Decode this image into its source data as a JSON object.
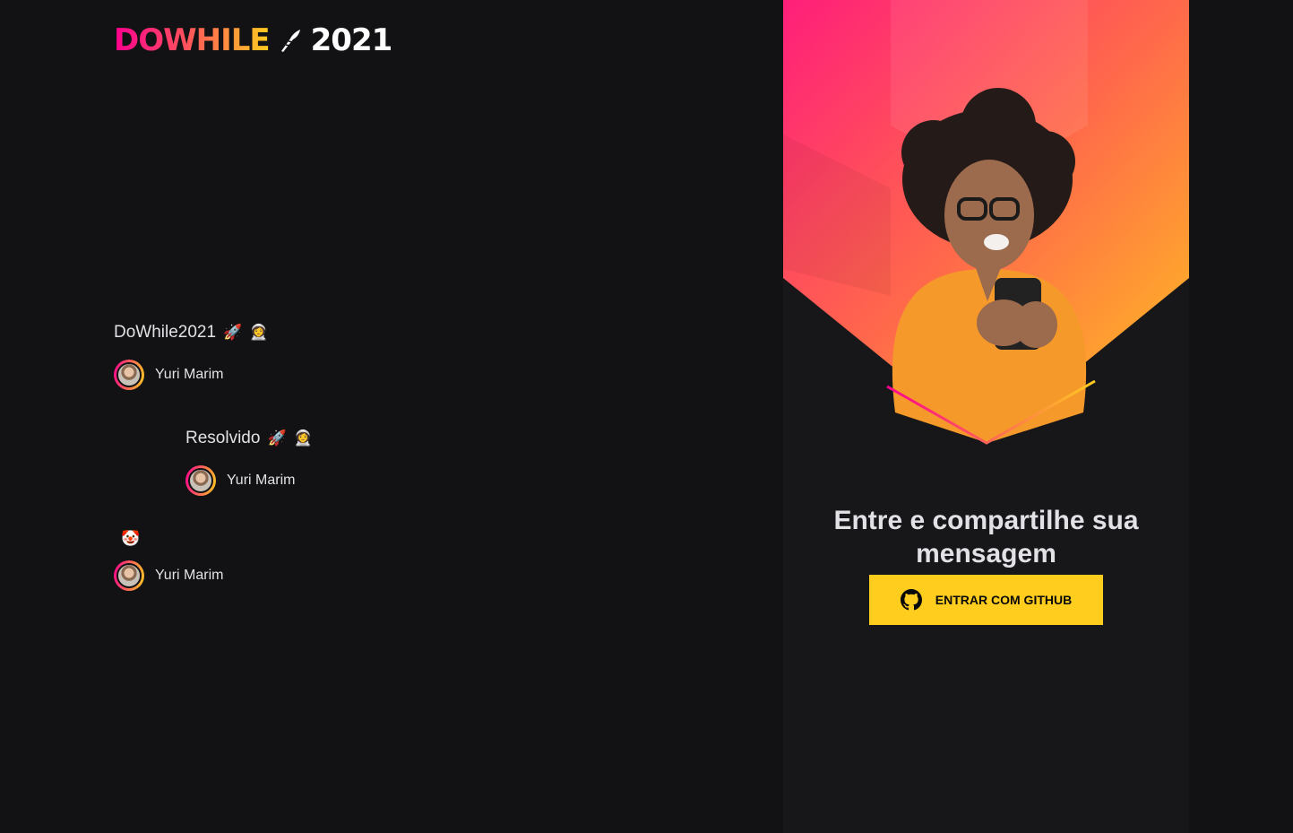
{
  "brand": {
    "logo_word": "DOWHILE",
    "logo_year": "2021",
    "gradient_colors": [
      "#ff008e",
      "#ff4f5e",
      "#ffcd1e"
    ]
  },
  "messages": [
    {
      "text": "DoWhile2021",
      "emojis": [
        "🚀",
        "👩‍🚀"
      ],
      "user": "Yuri Marim"
    },
    {
      "text": "Resolvido",
      "emojis": [
        "🚀",
        "👩‍🚀"
      ],
      "user": "Yuri Marim"
    },
    {
      "text": "",
      "emojis": [
        "🤡"
      ],
      "user": "Yuri Marim"
    }
  ],
  "login": {
    "title": "Entre e compartilhe sua mensagem",
    "button_label": "Entrar com GitHub",
    "button_icon": "github-icon",
    "button_color": "#ffcd1e"
  },
  "colors": {
    "background": "#121214",
    "panel": "#17171a",
    "text": "#e1e1e6"
  }
}
